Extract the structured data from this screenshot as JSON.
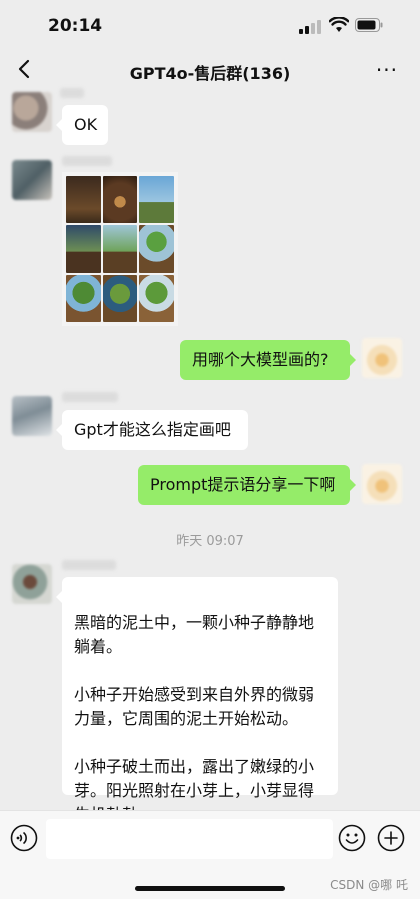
{
  "status_bar": {
    "time": "20:14"
  },
  "nav": {
    "title": "GPT4o-售后群(136)",
    "more": "···"
  },
  "messages": {
    "ok": "OK",
    "question": "用哪个大模型画的?",
    "gpt_reply": "Gpt才能这么指定画吧",
    "prompt_ask": "Prompt提示语分享一下啊",
    "story": "黑暗的泥土中，一颗小种子静静地躺着。\n\n小种子开始感受到来自外界的微弱力量，它周围的泥土开始松动。\n\n小种子破土而出，露出了嫩绿的小芽。阳光照射在小芽上，小芽显得生机勃勃。"
  },
  "timestamp": "昨天 09:07",
  "watermark": "CSDN @哪 吒",
  "colors": {
    "background": "#ededed",
    "bubble_mine": "#95ec69",
    "bubble_other": "#ffffff"
  },
  "icons": [
    "back-icon",
    "more-icon",
    "voice-icon",
    "emoji-icon",
    "plus-icon",
    "signal-icon",
    "wifi-icon",
    "battery-icon"
  ]
}
